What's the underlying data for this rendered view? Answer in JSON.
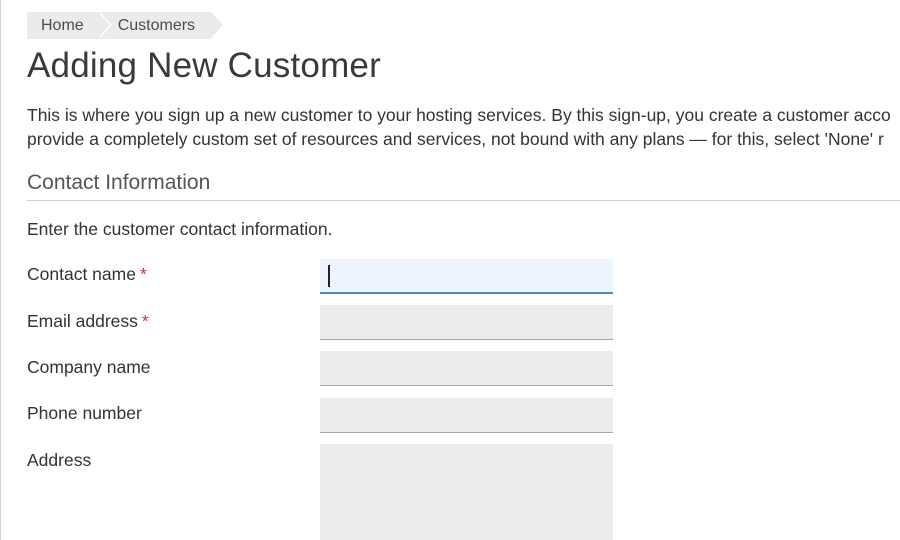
{
  "breadcrumb": {
    "items": [
      {
        "label": "Home"
      },
      {
        "label": "Customers"
      }
    ]
  },
  "page": {
    "title": "Adding New Customer",
    "intro_line1": "This is where you sign up a new customer to your hosting services. By this sign-up, you create a customer acco",
    "intro_line2": "provide a completely custom set of resources and services, not bound with any plans — for this, select 'None' r"
  },
  "contact_section": {
    "title": "Contact Information",
    "hint": "Enter the customer contact information.",
    "required_marker": "*",
    "fields": {
      "contact_name": {
        "label": "Contact name",
        "value": "",
        "required": true
      },
      "email": {
        "label": "Email address",
        "value": "",
        "required": true
      },
      "company": {
        "label": "Company name",
        "value": "",
        "required": false
      },
      "phone": {
        "label": "Phone number",
        "value": "",
        "required": false
      },
      "address": {
        "label": "Address",
        "value": "",
        "required": false
      }
    }
  },
  "colors": {
    "required_marker": "#c0392b",
    "focus_border": "#4a8bc4",
    "input_background": "#ececec",
    "focused_input_background": "#eef4fb",
    "breadcrumb_background": "#ebebeb"
  }
}
